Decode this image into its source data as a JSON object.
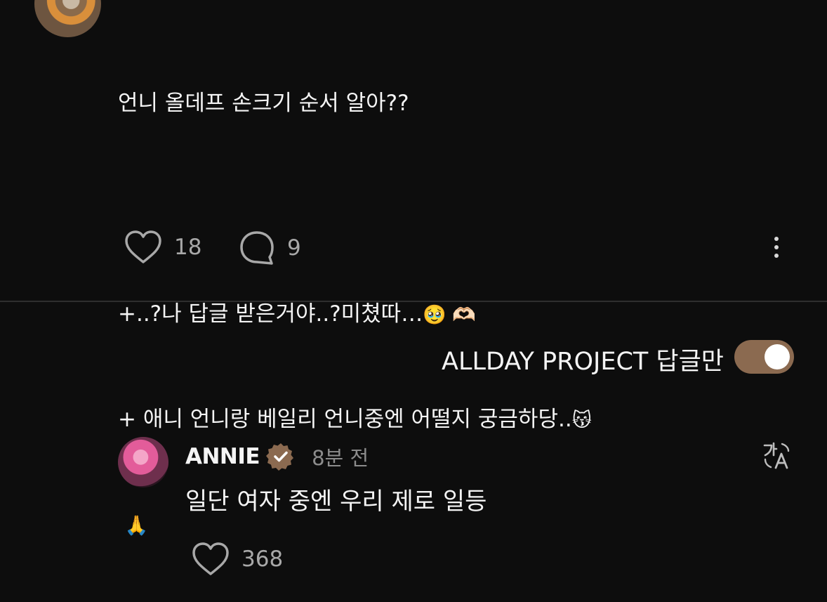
{
  "post": {
    "lines": [
      "언니 올데프 손크기 순서 알아??",
      "",
      "+..?나 답글 받은거야..?미쳤따…",
      "+ 애니 언니랑 베일리 언니중엔 어떨지 궁금하당..",
      ""
    ],
    "line3_emojis": "🥹 🫶🏻",
    "line4_emoji": "😽",
    "line5_emoji": "🙏",
    "like_count": "18",
    "reply_count": "9"
  },
  "filter": {
    "label": "ALLDAY PROJECT 답글만",
    "toggle_on": true,
    "toggle_color": "#8b6a50"
  },
  "reply": {
    "author": "ANNIE",
    "verified": true,
    "time": "8분 전",
    "text": "일단 여자 중엔 우리 제로 일등",
    "like_count": "368"
  },
  "icons": {
    "like": "heart-icon",
    "reply": "speech-bubble-icon",
    "more": "more-vertical-icon",
    "translate": "translate-icon",
    "verified": "verified-badge-icon"
  }
}
